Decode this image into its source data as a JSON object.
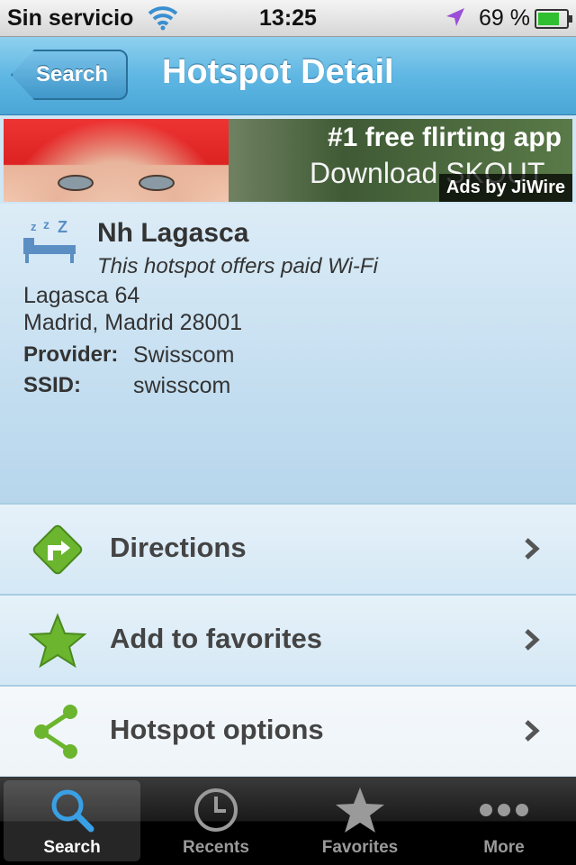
{
  "status_bar": {
    "carrier": "Sin servicio",
    "time": "13:25",
    "battery": "69 %",
    "battery_level": 0.69
  },
  "nav": {
    "back_label": "Search",
    "title": "Hotspot Detail"
  },
  "ad": {
    "headline": "#1 free flirting app",
    "subline": "Download SKOUT",
    "tag": "Ads by JiWire"
  },
  "hotspot": {
    "name": "Nh Lagasca",
    "description": "This hotspot offers paid Wi-Fi",
    "address_line1": "Lagasca 64",
    "address_line2": "Madrid, Madrid 28001",
    "provider_label": "Provider:",
    "provider": "Swisscom",
    "ssid_label": "SSID:",
    "ssid": "swisscom"
  },
  "actions": [
    {
      "label": "Directions",
      "icon": "directions-icon"
    },
    {
      "label": "Add to favorites",
      "icon": "star-icon"
    },
    {
      "label": "Hotspot options",
      "icon": "share-icon"
    }
  ],
  "tabs": [
    {
      "label": "Search",
      "icon": "search-icon",
      "active": true
    },
    {
      "label": "Recents",
      "icon": "clock-icon",
      "active": false
    },
    {
      "label": "Favorites",
      "icon": "star-icon",
      "active": false
    },
    {
      "label": "More",
      "icon": "more-icon",
      "active": false
    }
  ]
}
